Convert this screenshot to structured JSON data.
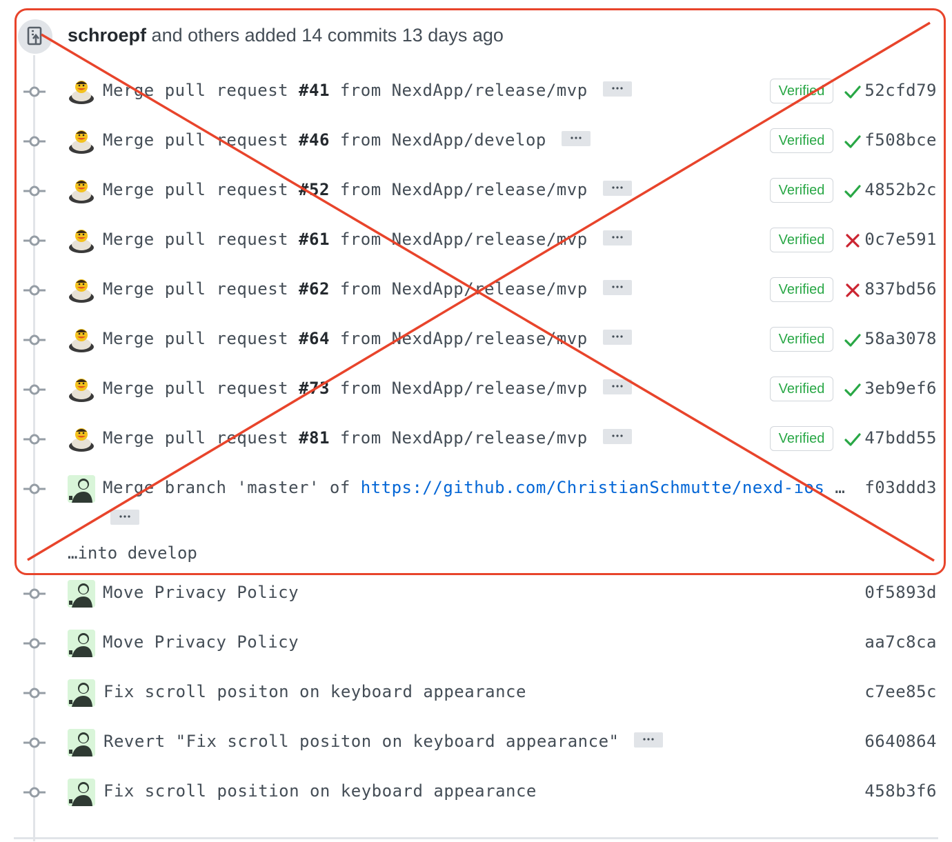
{
  "header": {
    "author": "schroepf",
    "summary": "and others added 14 commits 13 days ago"
  },
  "icons": {
    "push": "repo-push-icon",
    "commit": "git-commit-icon",
    "more": "kebab-horizontal-icon",
    "check": "check-icon",
    "x": "x-icon"
  },
  "colors": {
    "verified": "#28a745",
    "failure": "#cb2431",
    "link": "#0366d6",
    "annotation": "#e8442b"
  },
  "commits": [
    {
      "prefix": "Merge pull request ",
      "number": "#41",
      "suffix": " from NexdApp/release/mvp",
      "verified": "Verified",
      "status": "success",
      "sha": "52cfd79"
    },
    {
      "prefix": "Merge pull request ",
      "number": "#46",
      "suffix": " from NexdApp/develop",
      "verified": "Verified",
      "status": "success",
      "sha": "f508bce"
    },
    {
      "prefix": "Merge pull request ",
      "number": "#52",
      "suffix": " from NexdApp/release/mvp",
      "verified": "Verified",
      "status": "success",
      "sha": "4852b2c"
    },
    {
      "prefix": "Merge pull request ",
      "number": "#61",
      "suffix": " from NexdApp/release/mvp",
      "verified": "Verified",
      "status": "failure",
      "sha": "0c7e591"
    },
    {
      "prefix": "Merge pull request ",
      "number": "#62",
      "suffix": " from NexdApp/release/mvp",
      "verified": "Verified",
      "status": "failure",
      "sha": "837bd56"
    },
    {
      "prefix": "Merge pull request ",
      "number": "#64",
      "suffix": " from NexdApp/release/mvp",
      "verified": "Verified",
      "status": "success",
      "sha": "58a3078"
    },
    {
      "prefix": "Merge pull request ",
      "number": "#73",
      "suffix": " from NexdApp/release/mvp",
      "verified": "Verified",
      "status": "success",
      "sha": "3eb9ef6"
    },
    {
      "prefix": "Merge pull request ",
      "number": "#81",
      "suffix": " from NexdApp/release/mvp",
      "verified": "Verified",
      "status": "success",
      "sha": "47bdd55"
    },
    {
      "prefix": "Merge branch 'master' of ",
      "link": "https://github.com/ChristianSchmutte/nexd-ios",
      "trailing": " …",
      "continuation": "…into develop",
      "sha": "f03ddd3"
    },
    {
      "text": "Move Privacy Policy",
      "sha": "0f5893d"
    },
    {
      "text": "Move Privacy Policy",
      "sha": "aa7c8ca"
    },
    {
      "text": "Fix scroll positon on keyboard appearance",
      "sha": "c7ee85c"
    },
    {
      "text": "Revert \"Fix scroll positon on keyboard appearance\"",
      "sha": "6640864"
    },
    {
      "text": "Fix scroll position on keyboard appearance",
      "sha": "458b3f6"
    }
  ]
}
